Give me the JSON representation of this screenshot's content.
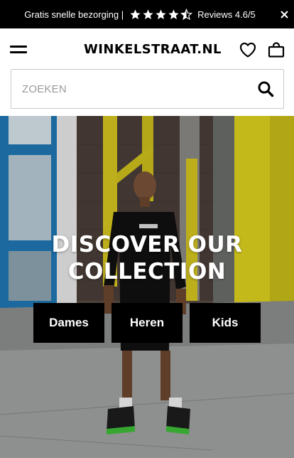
{
  "announcement": {
    "text": "Gratis snelle bezorging |",
    "rating_text": "Reviews 4.6/5",
    "rating_value": 4.6,
    "rating_max": 5,
    "star_icons": [
      "star-icon",
      "star-icon",
      "star-icon",
      "star-icon",
      "star-half-icon"
    ],
    "close_icon": "close-icon"
  },
  "header": {
    "menu_icon": "hamburger-menu-icon",
    "logo": "WINKELSTRAAT.NL",
    "wishlist_icon": "heart-icon",
    "cart_icon": "shopping-bag-icon"
  },
  "search": {
    "placeholder": "ZOEKEN",
    "value": "",
    "icon": "search-icon"
  },
  "hero": {
    "title_line1": "DISCOVER OUR",
    "title_line2": "COLLECTION",
    "categories": [
      {
        "label": "Dames"
      },
      {
        "label": "Heren"
      },
      {
        "label": "Kids"
      }
    ]
  },
  "colors": {
    "topbar_bg": "#000000",
    "button_bg": "#000000",
    "text_light": "#ffffff",
    "accent_yellow": "#e0d31e"
  }
}
